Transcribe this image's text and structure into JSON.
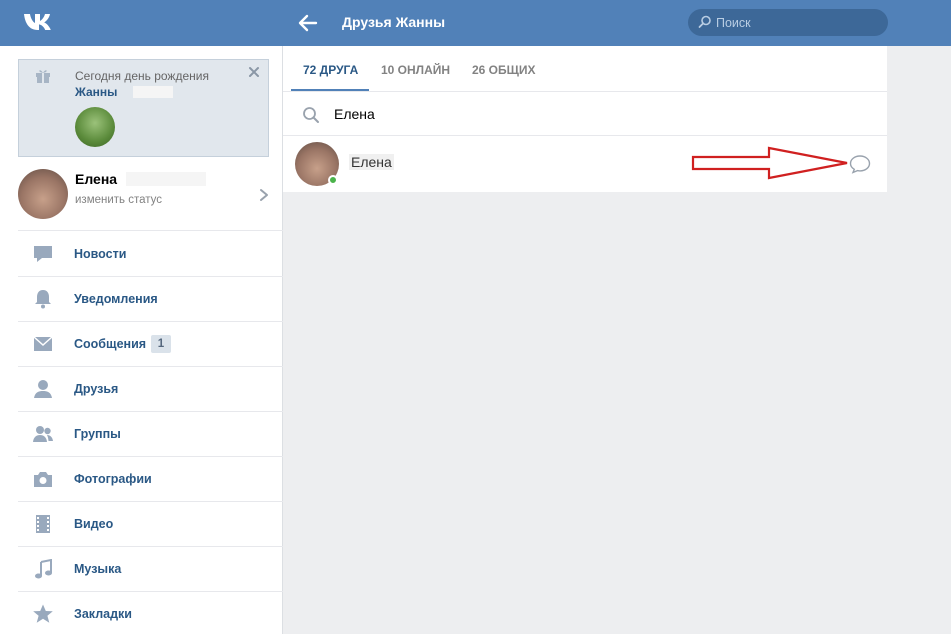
{
  "header": {
    "logo": "vk-logo",
    "title": "Друзья Жанны",
    "search_placeholder": "Поиск"
  },
  "birthday": {
    "text": "Сегодня день рождения",
    "name": "Жанны"
  },
  "profile": {
    "name": "Елена",
    "status": "изменить статус"
  },
  "menu": [
    {
      "label": "Новости",
      "icon": "news-icon"
    },
    {
      "label": "Уведомления",
      "icon": "bell-icon"
    },
    {
      "label": "Сообщения",
      "icon": "mail-icon",
      "badge": "1"
    },
    {
      "label": "Друзья",
      "icon": "user-icon"
    },
    {
      "label": "Группы",
      "icon": "groups-icon"
    },
    {
      "label": "Фотографии",
      "icon": "camera-icon"
    },
    {
      "label": "Видео",
      "icon": "film-icon"
    },
    {
      "label": "Музыка",
      "icon": "music-icon"
    },
    {
      "label": "Закладки",
      "icon": "star-icon"
    }
  ],
  "tabs": [
    {
      "label": "72 ДРУГА",
      "active": true
    },
    {
      "label": "10 ОНЛАЙН",
      "active": false
    },
    {
      "label": "26 ОБЩИХ",
      "active": false
    }
  ],
  "friend_search": {
    "value": "Елена"
  },
  "friends": [
    {
      "name": "Елена",
      "online": true
    }
  ],
  "colors": {
    "header": "#5181b8",
    "link": "#2a5885",
    "background": "#edeef0",
    "online": "#4bb34b",
    "annotation_arrow": "#d02020"
  }
}
